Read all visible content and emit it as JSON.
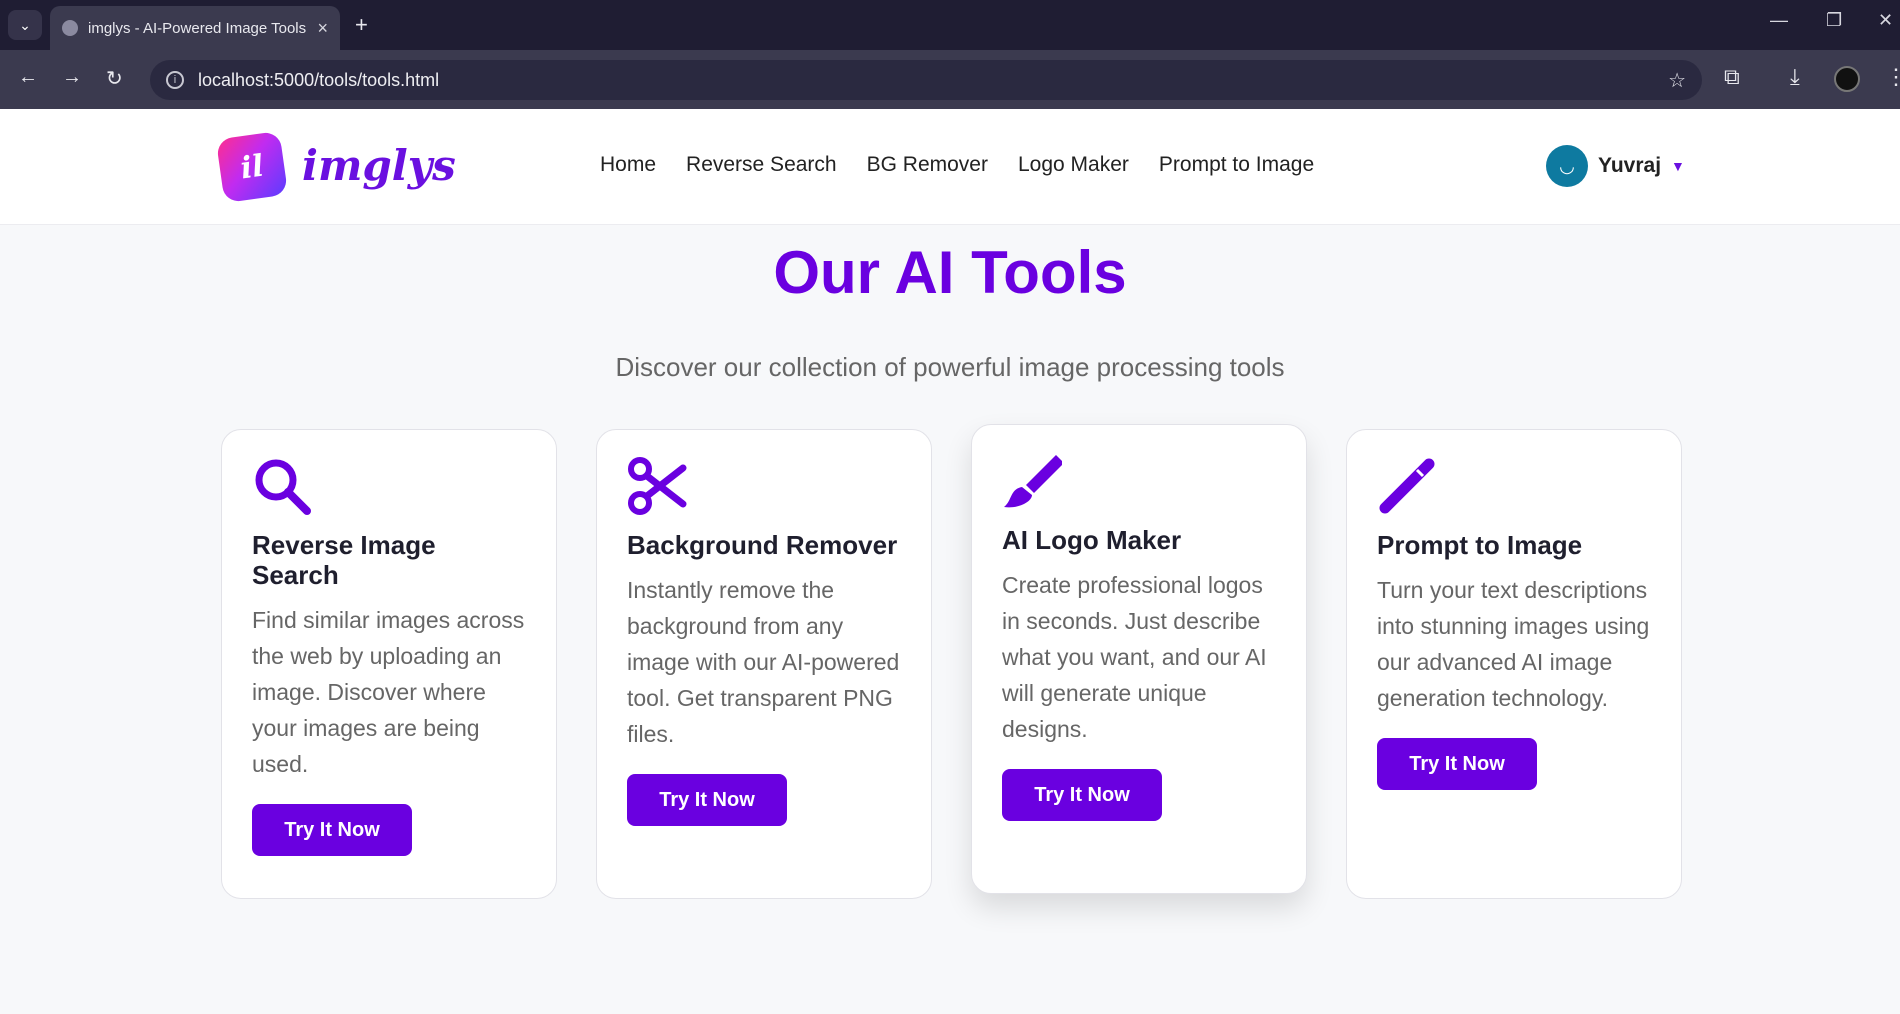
{
  "browser": {
    "tab_title": "imglys - AI-Powered Image Tools",
    "url": "localhost:5000/tools/tools.html"
  },
  "brand": {
    "mark": "il",
    "name": "imglys",
    "accent": "#6a00e0"
  },
  "nav": {
    "items": [
      "Home",
      "Reverse Search",
      "BG Remover",
      "Logo Maker",
      "Prompt to Image"
    ]
  },
  "user": {
    "name": "Yuvraj"
  },
  "hero": {
    "title": "Our AI Tools",
    "subtitle": "Discover our collection of powerful image processing tools"
  },
  "cards": [
    {
      "icon": "search-icon",
      "title": "Reverse Image Search",
      "text": "Find similar images across the web by uploading an image. Discover where your images are being used.",
      "button": "Try It Now"
    },
    {
      "icon": "scissors-icon",
      "title": "Background Remover",
      "text": "Instantly remove the background from any image with our AI-powered tool. Get transparent PNG files.",
      "button": "Try It Now"
    },
    {
      "icon": "paintbrush-icon",
      "title": "AI Logo Maker",
      "text": "Create professional logos in seconds. Just describe what you want, and our AI will generate unique designs.",
      "button": "Try It Now"
    },
    {
      "icon": "pen-icon",
      "title": "Prompt to Image",
      "text": "Turn your text descriptions into stunning images using our advanced AI image generation technology.",
      "button": "Try It Now"
    }
  ]
}
